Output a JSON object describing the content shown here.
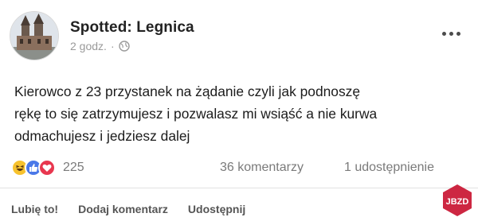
{
  "post": {
    "page_name": "Spotted: Legnica",
    "time": "2 godz.",
    "separator": "·",
    "text_lines": [
      "Kierowco z 23 przystanek na żądanie czyli jak podnoszę",
      "rękę to się zatrzymujesz i pozwalasz mi wsiąść a nie kurwa",
      "odmachujesz i jedziesz dalej"
    ]
  },
  "stats": {
    "reaction_icons": [
      "haha-icon",
      "like-icon",
      "love-icon"
    ],
    "reaction_count": "225",
    "comments": "36 komentarzy",
    "shares": "1 udostępnienie"
  },
  "actions": {
    "like": "Lubię to!",
    "comment": "Dodaj komentarz",
    "share": "Udostępnij"
  },
  "colors": {
    "haha": "#f7c22e",
    "like": "#4a78e8",
    "love": "#e8374f",
    "watermark": "#c8102e"
  },
  "watermark": {
    "text": "JBZD"
  }
}
